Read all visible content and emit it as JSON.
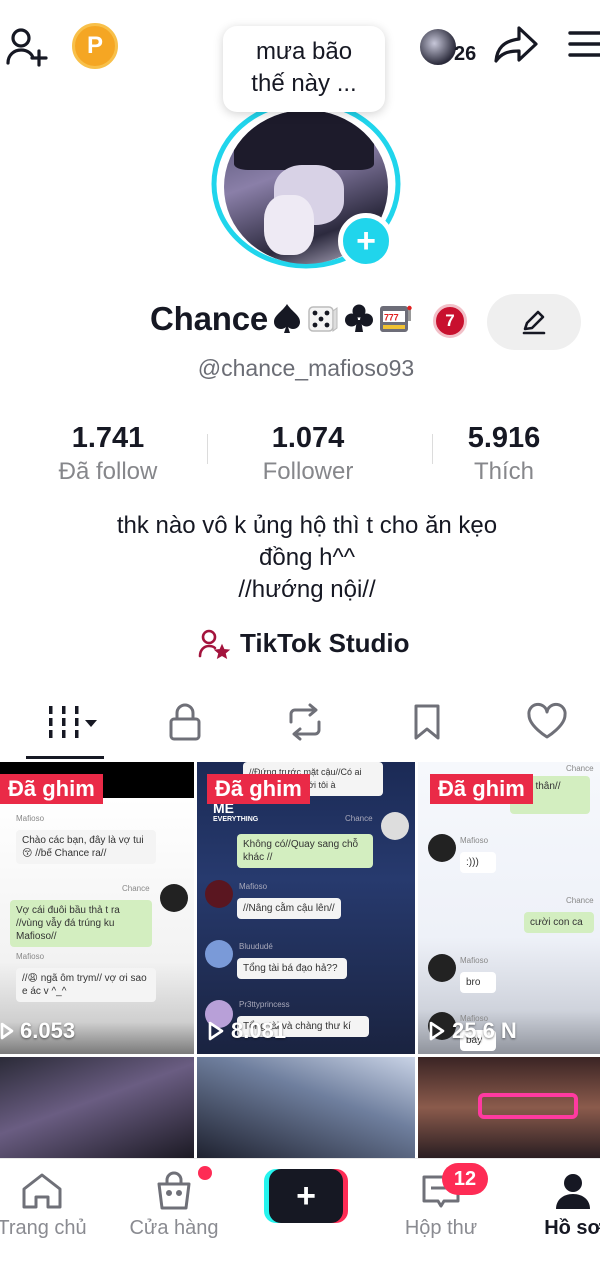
{
  "header": {
    "viewer_count": "26",
    "coin_letter": "P"
  },
  "bubble": {
    "line1": "mưa bão",
    "line2": "thế này ..."
  },
  "profile": {
    "name": "Chance",
    "name_emojis": [
      "spade-suit",
      "dice",
      "club-suit",
      "slot-machine"
    ],
    "level_badge": "7",
    "handle": "@chance_mafioso93"
  },
  "stats": [
    {
      "value": "1.741",
      "label": "Đã follow"
    },
    {
      "value": "1.074",
      "label": "Follower"
    },
    {
      "value": "5.916",
      "label": "Thích"
    }
  ],
  "bio": {
    "line1": "thk nào vô k ủng hộ thì t cho ăn kẹo",
    "line2": "đồng h^^",
    "line3": "//hướng nội//"
  },
  "studio_label": "TikTok Studio",
  "tabs": [
    "videos-grid-icon",
    "lock-icon",
    "repost-icon",
    "bookmark-icon",
    "heart-icon"
  ],
  "videos": [
    {
      "pinned": "Đã ghim",
      "views": "6.053",
      "chat": {
        "name_mafioso": "Mafioso",
        "msg1": "Chào các bạn, đây là vợ tui 😚 //bế Chance ra//",
        "name_chance": "Chance",
        "msg2": "Vợ cái đuôi bầu thả t ra //vùng vẫy đá trúng ku Mafioso//",
        "name_mafioso2": "Mafioso",
        "msg3": "//😩 ngã ôm trym// vợ ơi sao e ác v ^_^"
      }
    },
    {
      "pinned": "Đã ghim",
      "views": "8.081",
      "chat": {
        "top": "//Đứng trước mặt cậu//Có ai đang ăn hiếp với tôi à",
        "me": "ME",
        "everything": "EVERYTHING",
        "name_chance": "Chance",
        "msg1": "Không có//Quay sang chỗ khác //",
        "name_mafioso": "Mafioso",
        "msg2": "//Nâng cằm cậu lên//",
        "name_bluu": "Bluududé",
        "msg3": "Tổng tài bá đạo hả??",
        "name_pr": "Pr3ttyprincess",
        "msg4": "Tổng tài và chàng thư kí"
      }
    },
    {
      "pinned": "Đã ghim",
      "views": "25,6 N",
      "chat": {
        "name_chance": "Chance",
        "msg0": "tình thân//",
        "name_mafioso": "Mafioso",
        "msg1": ":)))",
        "name_chance2": "Chance",
        "msg2": "cười con ca",
        "name_mafioso2": "Mafioso",
        "msg3": "bro",
        "name_mafioso3": "Mafioso",
        "msg4": "bay"
      }
    }
  ],
  "nav": {
    "home": "Trang chủ",
    "shop": "Cửa hàng",
    "inbox": "Hộp thư",
    "inbox_badge": "12",
    "profile": "Hồ sơ"
  },
  "colors": {
    "accent_cyan": "#20d5ec",
    "pin_red": "#ea2a47",
    "tiktok_pink": "#fe2c55",
    "tiktok_cyan": "#25f4ee"
  }
}
